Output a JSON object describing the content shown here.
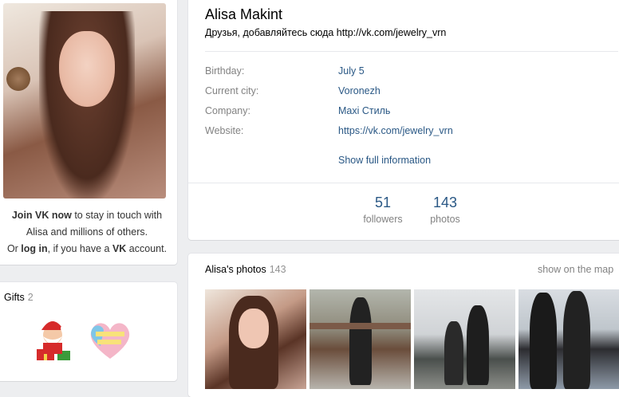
{
  "profile": {
    "name": "Alisa Makint",
    "status": "Друзья, добавляйтесь сюда http://vk.com/jewelry_vrn"
  },
  "join": {
    "bold1": "Join VK now",
    "text1": " to stay in touch with Alisa and millions of others.",
    "text2": "Or ",
    "login": "log in",
    "text3": ", if you have a ",
    "vk": "VK",
    "text4": " account."
  },
  "gifts": {
    "title": "Gifts",
    "count": "2",
    "items": [
      "santa-gift-icon",
      "valentines-day-heart-icon"
    ]
  },
  "info": {
    "rows": [
      {
        "label": "Birthday:",
        "value": "July 5"
      },
      {
        "label": "Current city:",
        "value": "Voronezh"
      },
      {
        "label": "Company:",
        "value": "Maxi Стиль"
      },
      {
        "label": "Website:",
        "value": "https://vk.com/jewelry_vrn"
      }
    ],
    "show_full": "Show full information"
  },
  "counters": {
    "followers": {
      "num": "51",
      "label": "followers"
    },
    "photos": {
      "num": "143",
      "label": "photos"
    }
  },
  "photos": {
    "title": "Alisa's photos",
    "count": "143",
    "show_map": "show on the map"
  },
  "colors": {
    "link": "#2a5885",
    "muted": "#828282",
    "background": "#edeef0"
  }
}
